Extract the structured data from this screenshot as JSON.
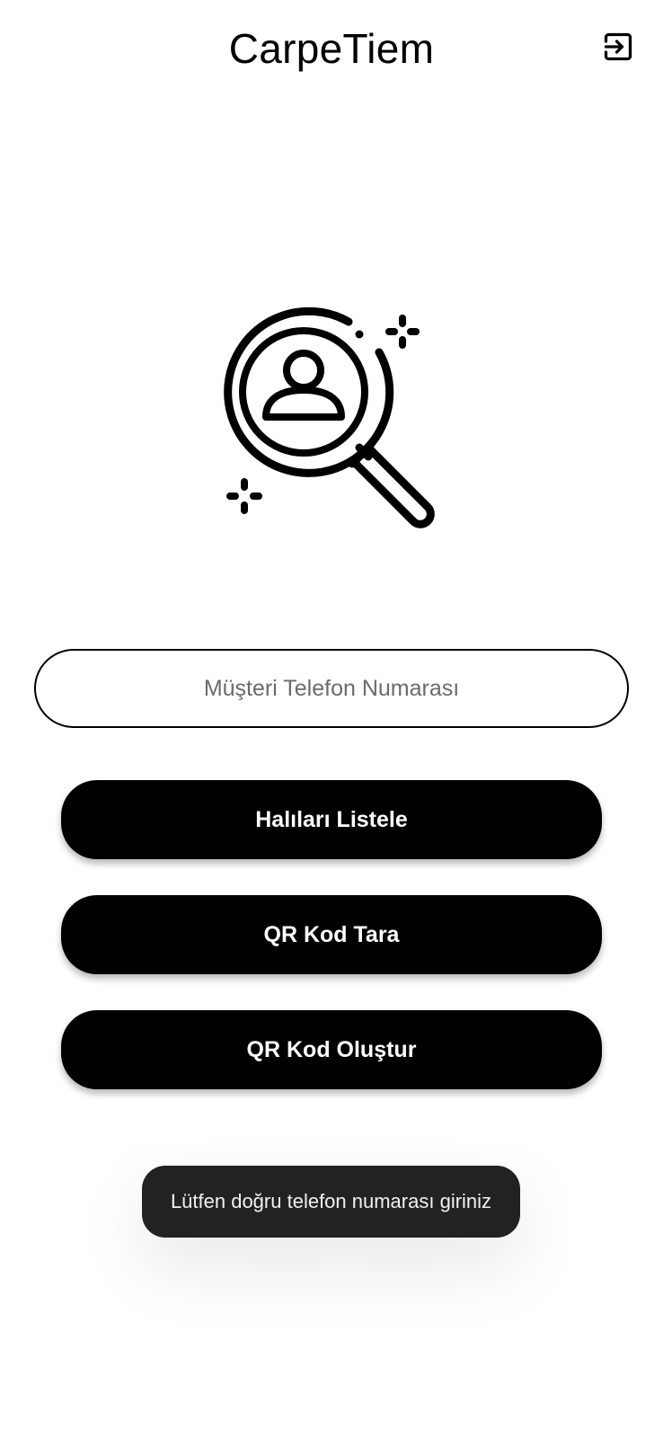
{
  "app_bar": {
    "title": "CarpeTiem",
    "logout_icon": "logout-icon"
  },
  "hero": {
    "icon": "search-customer-icon"
  },
  "phone_input": {
    "value": "",
    "placeholder": "Müşteri Telefon Numarası"
  },
  "buttons": {
    "list_carpets": "Halıları Listele",
    "scan_qr": "QR Kod Tara",
    "create_qr": "QR Kod Oluştur"
  },
  "toast": {
    "message": "Lütfen doğru telefon numarası giriniz"
  },
  "colors": {
    "primary": "#000000",
    "background": "#ffffff",
    "toast_background": "#222222",
    "toast_text": "#f1f1f1"
  }
}
